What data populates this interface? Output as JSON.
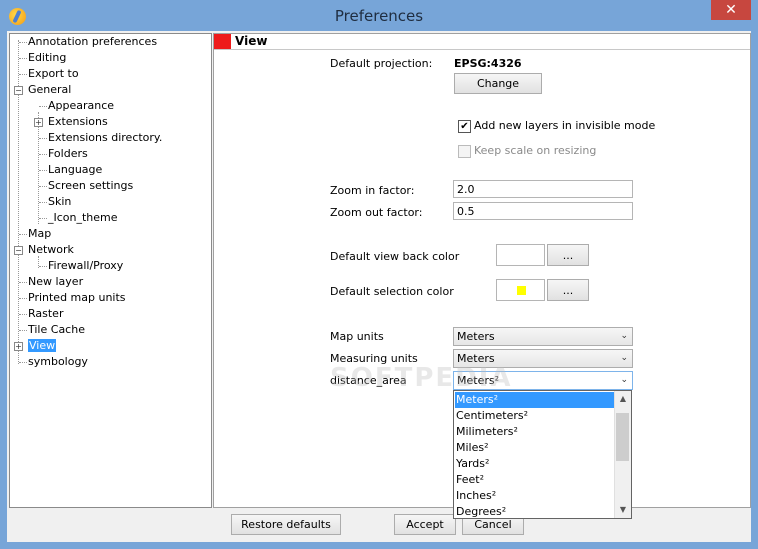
{
  "window": {
    "title": "Preferences",
    "close_symbol": "✕"
  },
  "tree": {
    "items": [
      {
        "label": "Annotation preferences"
      },
      {
        "label": "Editing"
      },
      {
        "label": "Export to"
      },
      {
        "label": "General"
      },
      {
        "label": "Appearance"
      },
      {
        "label": "Extensions"
      },
      {
        "label": "Extensions directory."
      },
      {
        "label": "Folders"
      },
      {
        "label": "Language"
      },
      {
        "label": "Screen settings"
      },
      {
        "label": "Skin"
      },
      {
        "label": "_Icon_theme"
      },
      {
        "label": "Map"
      },
      {
        "label": "Network"
      },
      {
        "label": "Firewall/Proxy"
      },
      {
        "label": "New layer"
      },
      {
        "label": "Printed map units"
      },
      {
        "label": "Raster"
      },
      {
        "label": "Tile Cache"
      },
      {
        "label": "View"
      },
      {
        "label": "symbology"
      }
    ],
    "expand_plus": "+",
    "expand_minus": "−"
  },
  "panel": {
    "header": "View",
    "default_projection_label": "Default projection:",
    "default_projection_value": "EPSG:4326",
    "change_button": "Change",
    "add_layers_invisible_label": "Add new layers in invisible mode",
    "add_layers_invisible_checked": true,
    "keep_scale_label": "Keep scale on resizing",
    "keep_scale_checked": false,
    "check_mark": "✔",
    "zoom_in_label": "Zoom in factor:",
    "zoom_in_value": "2.0",
    "zoom_out_label": "Zoom out factor:",
    "zoom_out_value": "0.5",
    "back_color_label": "Default view back color",
    "back_color": "#ffffff",
    "selection_color_label": "Default selection color",
    "selection_color": "#ffff00",
    "ellipsis_button": "...",
    "map_units_label": "Map units",
    "map_units_value": "Meters",
    "measuring_units_label": "Measuring units",
    "measuring_units_value": "Meters",
    "distance_area_label": "distance_area",
    "distance_area_value": "Meters²",
    "combo_arrow": "⌄",
    "distance_area_options": [
      "Meters²",
      "Centimeters²",
      "Milimeters²",
      "Miles²",
      "Yards²",
      "Feet²",
      "Inches²",
      "Degrees²"
    ],
    "scroll_up": "▲",
    "scroll_down": "▼"
  },
  "footer": {
    "restore_defaults": "Restore defaults",
    "accept": "Accept",
    "cancel": "Cancel"
  },
  "watermark": "SOFTPEDIA",
  "colors": {
    "accent": "#3399ff",
    "header_mark": "#ee1b1b",
    "close": "#c7473f"
  }
}
